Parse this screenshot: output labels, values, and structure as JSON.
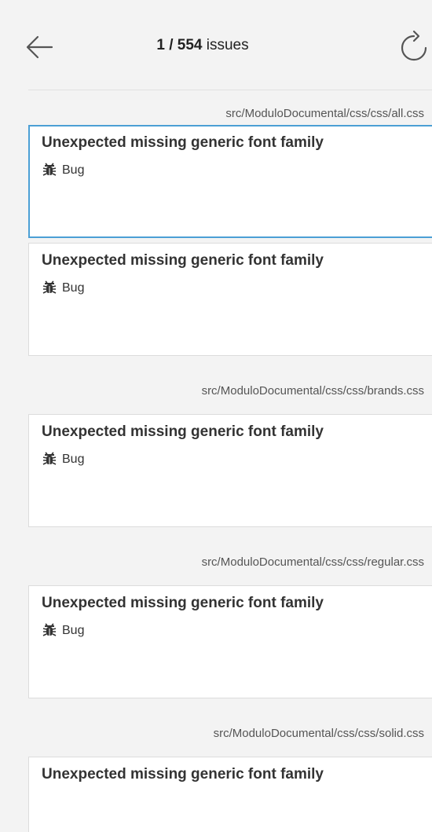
{
  "header": {
    "counter_current": "1 / 554",
    "counter_suffix": " issues",
    "back_icon": "arrow-left-icon",
    "reload_icon": "refresh-icon"
  },
  "groups": [
    {
      "file": "src/ModuloDocumental/css/css/all.css",
      "issues": [
        {
          "title": "Unexpected missing generic font family",
          "type": "Bug",
          "selected": true
        },
        {
          "title": "Unexpected missing generic font family",
          "type": "Bug",
          "selected": false
        }
      ]
    },
    {
      "file": "src/ModuloDocumental/css/css/brands.css",
      "issues": [
        {
          "title": "Unexpected missing generic font family",
          "type": "Bug",
          "selected": false
        }
      ]
    },
    {
      "file": "src/ModuloDocumental/css/css/regular.css",
      "issues": [
        {
          "title": "Unexpected missing generic font family",
          "type": "Bug",
          "selected": false
        }
      ]
    },
    {
      "file": "src/ModuloDocumental/css/css/solid.css",
      "issues": [
        {
          "title": "Unexpected missing generic font family",
          "type": "",
          "selected": false
        }
      ]
    }
  ],
  "colors": {
    "selected_border": "#4b9fd5",
    "background": "#f3f3f3",
    "card": "#ffffff"
  }
}
